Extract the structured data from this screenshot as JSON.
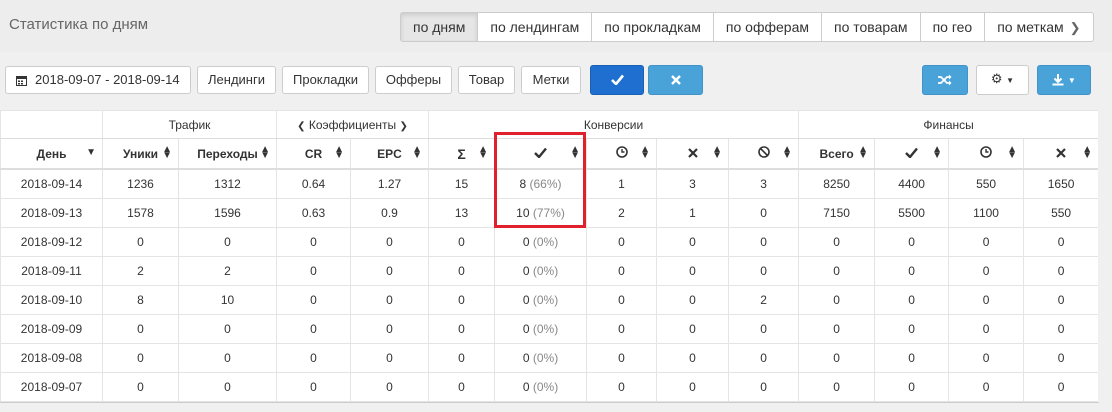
{
  "page": {
    "title": "Статистика по дням"
  },
  "tabs": [
    {
      "label": "по дням",
      "active": true
    },
    {
      "label": "по лендингам",
      "active": false
    },
    {
      "label": "по прокладкам",
      "active": false
    },
    {
      "label": "по офферам",
      "active": false
    },
    {
      "label": "по товарам",
      "active": false
    },
    {
      "label": "по гео",
      "active": false
    },
    {
      "label": "по меткам",
      "active": false
    }
  ],
  "filters": {
    "date_range": "2018-09-07 - 2018-09-14",
    "landings": "Лендинги",
    "prelandings": "Прокладки",
    "offers": "Офферы",
    "product": "Товар",
    "tags": "Метки"
  },
  "colors": {
    "apply": "#1f6fd1",
    "reset": "#4aa3d8",
    "highlight": "#e0202a"
  },
  "icons": {
    "calendar": "calendar-icon",
    "apply": "check-icon",
    "reset": "times-icon",
    "shuffle": "shuffle-icon",
    "settings": "gear-icon",
    "export": "download-icon"
  },
  "table": {
    "groups": {
      "traffic": "Трафик",
      "coefficients": "Коэффициенты",
      "conversions": "Конверсии",
      "finance": "Финансы"
    },
    "headers": {
      "day": "День",
      "uniques": "Уники",
      "clicks": "Переходы",
      "cr": "CR",
      "epc": "EPC",
      "sum": "Σ",
      "total": "Всего"
    },
    "rows": [
      {
        "day": "2018-09-14",
        "uniques": "1236",
        "clicks": "1312",
        "cr": "0.64",
        "epc": "1.27",
        "sum": "15",
        "approved": "8",
        "approved_pct": "(66%)",
        "hold": "1",
        "rejected": "3",
        "trash": "3",
        "total": "8250",
        "fin_approved": "4400",
        "fin_hold": "550",
        "fin_rejected": "1650"
      },
      {
        "day": "2018-09-13",
        "uniques": "1578",
        "clicks": "1596",
        "cr": "0.63",
        "epc": "0.9",
        "sum": "13",
        "approved": "10",
        "approved_pct": "(77%)",
        "hold": "2",
        "rejected": "1",
        "trash": "0",
        "total": "7150",
        "fin_approved": "5500",
        "fin_hold": "1100",
        "fin_rejected": "550"
      },
      {
        "day": "2018-09-12",
        "uniques": "0",
        "clicks": "0",
        "cr": "0",
        "epc": "0",
        "sum": "0",
        "approved": "0",
        "approved_pct": "(0%)",
        "hold": "0",
        "rejected": "0",
        "trash": "0",
        "total": "0",
        "fin_approved": "0",
        "fin_hold": "0",
        "fin_rejected": "0"
      },
      {
        "day": "2018-09-11",
        "uniques": "2",
        "clicks": "2",
        "cr": "0",
        "epc": "0",
        "sum": "0",
        "approved": "0",
        "approved_pct": "(0%)",
        "hold": "0",
        "rejected": "0",
        "trash": "0",
        "total": "0",
        "fin_approved": "0",
        "fin_hold": "0",
        "fin_rejected": "0"
      },
      {
        "day": "2018-09-10",
        "uniques": "8",
        "clicks": "10",
        "cr": "0",
        "epc": "0",
        "sum": "0",
        "approved": "0",
        "approved_pct": "(0%)",
        "hold": "0",
        "rejected": "0",
        "trash": "2",
        "total": "0",
        "fin_approved": "0",
        "fin_hold": "0",
        "fin_rejected": "0"
      },
      {
        "day": "2018-09-09",
        "uniques": "0",
        "clicks": "0",
        "cr": "0",
        "epc": "0",
        "sum": "0",
        "approved": "0",
        "approved_pct": "(0%)",
        "hold": "0",
        "rejected": "0",
        "trash": "0",
        "total": "0",
        "fin_approved": "0",
        "fin_hold": "0",
        "fin_rejected": "0"
      },
      {
        "day": "2018-09-08",
        "uniques": "0",
        "clicks": "0",
        "cr": "0",
        "epc": "0",
        "sum": "0",
        "approved": "0",
        "approved_pct": "(0%)",
        "hold": "0",
        "rejected": "0",
        "trash": "0",
        "total": "0",
        "fin_approved": "0",
        "fin_hold": "0",
        "fin_rejected": "0"
      },
      {
        "day": "2018-09-07",
        "uniques": "0",
        "clicks": "0",
        "cr": "0",
        "epc": "0",
        "sum": "0",
        "approved": "0",
        "approved_pct": "(0%)",
        "hold": "0",
        "rejected": "0",
        "trash": "0",
        "total": "0",
        "fin_approved": "0",
        "fin_hold": "0",
        "fin_rejected": "0"
      }
    ]
  }
}
